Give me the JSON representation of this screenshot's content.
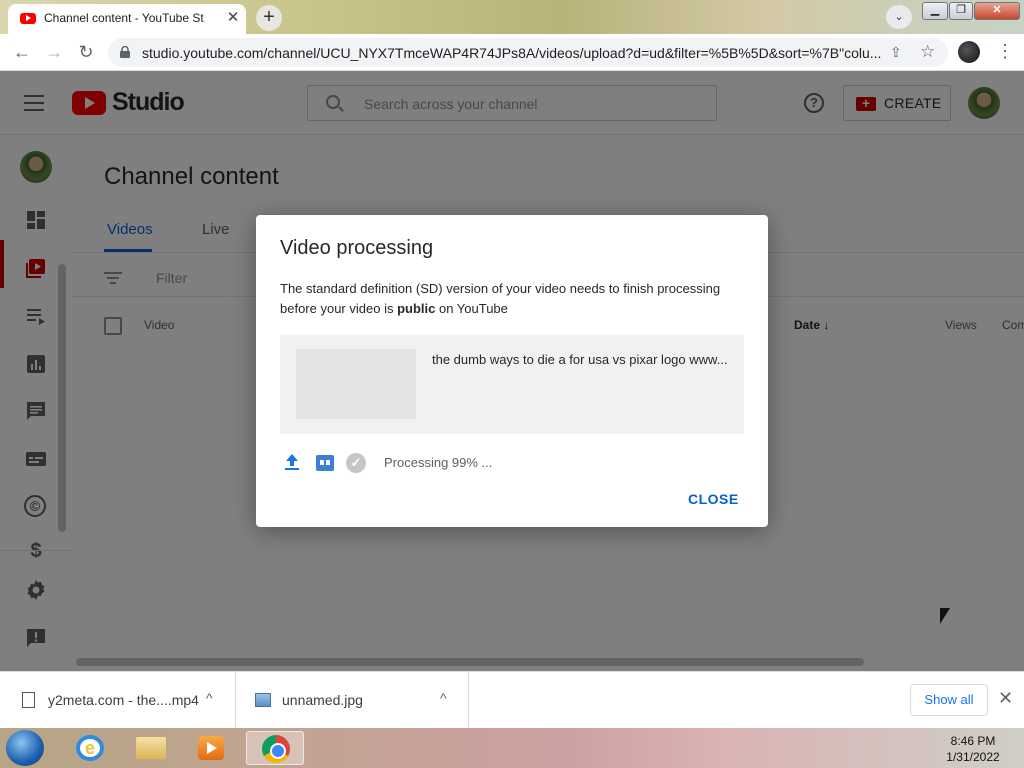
{
  "browser": {
    "tab_title": "Channel content - YouTube Studio",
    "tab_close": "✕",
    "new_tab": "+",
    "url": "studio.youtube.com/channel/UCU_NYX7TmceWAP4R74JPs8A/videos/upload?d=ud&filter=%5B%5D&sort=%7B\"colu...",
    "back_icon": "arrow-left",
    "forward_icon": "arrow-right",
    "reload_icon": "reload",
    "window_min": "▁",
    "window_restore": "❐",
    "window_close": "✕"
  },
  "header": {
    "logo_text": "Studio",
    "search_placeholder": "Search across your channel",
    "help": "?",
    "create_label": "CREATE",
    "create_icon": "+"
  },
  "sidebar": {
    "items": [
      {
        "icon": "dashboard-icon"
      },
      {
        "icon": "content-icon",
        "active": true
      },
      {
        "icon": "playlists-icon"
      },
      {
        "icon": "analytics-icon"
      },
      {
        "icon": "comments-icon"
      },
      {
        "icon": "subtitles-icon"
      },
      {
        "icon": "copyright-icon"
      },
      {
        "icon": "monetization-icon"
      },
      {
        "icon": "settings-icon"
      },
      {
        "icon": "feedback-icon"
      }
    ],
    "monetization_glyph": "$",
    "copyright_glyph": "©"
  },
  "main": {
    "title": "Channel content",
    "tabs": [
      {
        "label": "Videos",
        "active": true
      },
      {
        "label": "Live",
        "active": false
      }
    ],
    "filter_label": "Filter",
    "columns": {
      "video": "Video",
      "date": "Date",
      "date_arrow": "↓",
      "views": "Views",
      "comments": "Com"
    }
  },
  "dialog": {
    "title": "Video processing",
    "body_before": "The standard definition (SD) version of your video needs to finish processing before your video is ",
    "body_bold": "public",
    "body_after": " on YouTube",
    "video_title": "the dumb ways to die a for usa vs pixar logo www...",
    "check_glyph": "✓",
    "status": "Processing 99% ...",
    "progress_percent": 99,
    "close_label": "CLOSE"
  },
  "downloads": {
    "items": [
      {
        "name": "y2meta.com - the....mp4",
        "chevron": "^"
      },
      {
        "name": "unnamed.jpg",
        "chevron": "^"
      }
    ],
    "show_all": "Show all",
    "close": "✕"
  },
  "taskbar": {
    "time": "8:46 PM",
    "date": "1/31/2022",
    "ie_glyph": "e"
  },
  "colors": {
    "accent_blue": "#065fd4",
    "youtube_red": "#ff0000",
    "active_red": "#cc0000"
  }
}
